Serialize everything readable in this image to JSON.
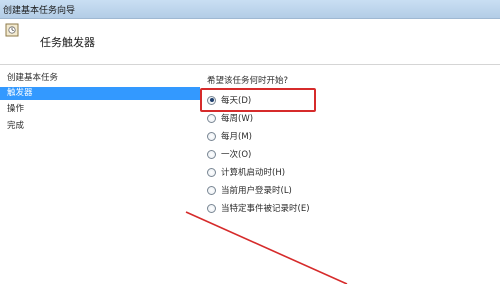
{
  "window": {
    "title": "创建基本任务向导"
  },
  "header": {
    "icon": "task-scheduler-icon",
    "title": "任务触发器"
  },
  "sidebar": {
    "items": [
      {
        "label": "创建基本任务",
        "selected": false
      },
      {
        "label": "触发器",
        "selected": true
      },
      {
        "label": "操作",
        "selected": false
      },
      {
        "label": "完成",
        "selected": false
      }
    ]
  },
  "content": {
    "question": "希望该任务何时开始?",
    "options": [
      {
        "label": "每天(D)",
        "checked": true
      },
      {
        "label": "每周(W)",
        "checked": false
      },
      {
        "label": "每月(M)",
        "checked": false
      },
      {
        "label": "一次(O)",
        "checked": false
      },
      {
        "label": "计算机启动时(H)",
        "checked": false
      },
      {
        "label": "当前用户登录时(L)",
        "checked": false
      },
      {
        "label": "当特定事件被记录时(E)",
        "checked": false
      }
    ]
  },
  "colors": {
    "annotation": "#d62b2b",
    "selection": "#3399ff"
  }
}
